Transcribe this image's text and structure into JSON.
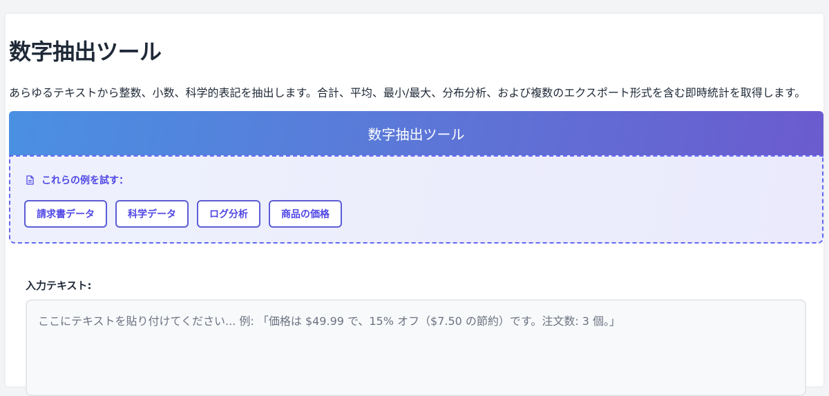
{
  "page": {
    "title": "数字抽出ツール",
    "description": "あらゆるテキストから整数、小数、科学的表記を抽出します。合計、平均、最小/最大、分布分析、および複数のエクスポート形式を含む即時統計を取得します。"
  },
  "tool": {
    "header_title": "数字抽出ツール",
    "examples_label": "これらの例を試す：",
    "examples": [
      "請求書データ",
      "科学データ",
      "ログ分析",
      "商品の価格"
    ],
    "input_label": "入力テキスト:",
    "input_placeholder": "ここにテキストを貼り付けてください... 例: 「価格は $49.99 で、15% オフ（$7.50 の節約）です。注文数: 3 個。」",
    "input_value": ""
  },
  "colors": {
    "accent": "#5048e5",
    "gradient_start": "#4a90e2",
    "gradient_end": "#6b5bcf"
  },
  "icons": {
    "examples_icon": "document-icon"
  }
}
